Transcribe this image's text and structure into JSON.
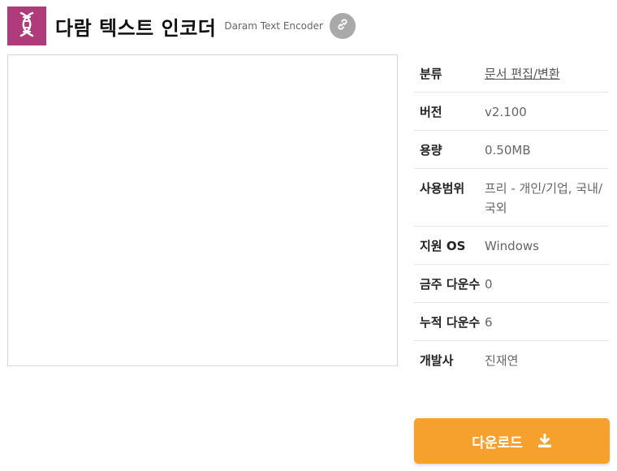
{
  "app": {
    "title": "다람 텍스트 인코더",
    "subtitle": "Daram Text Encoder",
    "logo_icon": "dna-icon",
    "link_icon": "link-icon"
  },
  "info": [
    {
      "label": "분류",
      "value": "문서 편집/변환",
      "is_link": true
    },
    {
      "label": "버전",
      "value": "v2.100"
    },
    {
      "label": "용량",
      "value": "0.50MB"
    },
    {
      "label": "사용범위",
      "value": "프리 - 개인/기업, 국내/국외"
    },
    {
      "label": "지원 OS",
      "value": "Windows"
    },
    {
      "label": "금주 다운수",
      "value": "0"
    },
    {
      "label": "누적 다운수",
      "value": "6"
    },
    {
      "label": "개발사",
      "value": "진재연"
    }
  ],
  "download": {
    "label": "다운로드",
    "icon": "download-icon"
  },
  "colors": {
    "logo_bg": "#b03b7a",
    "download_bg": "#f6a12d",
    "link_btn_bg": "#a9a9a9"
  }
}
